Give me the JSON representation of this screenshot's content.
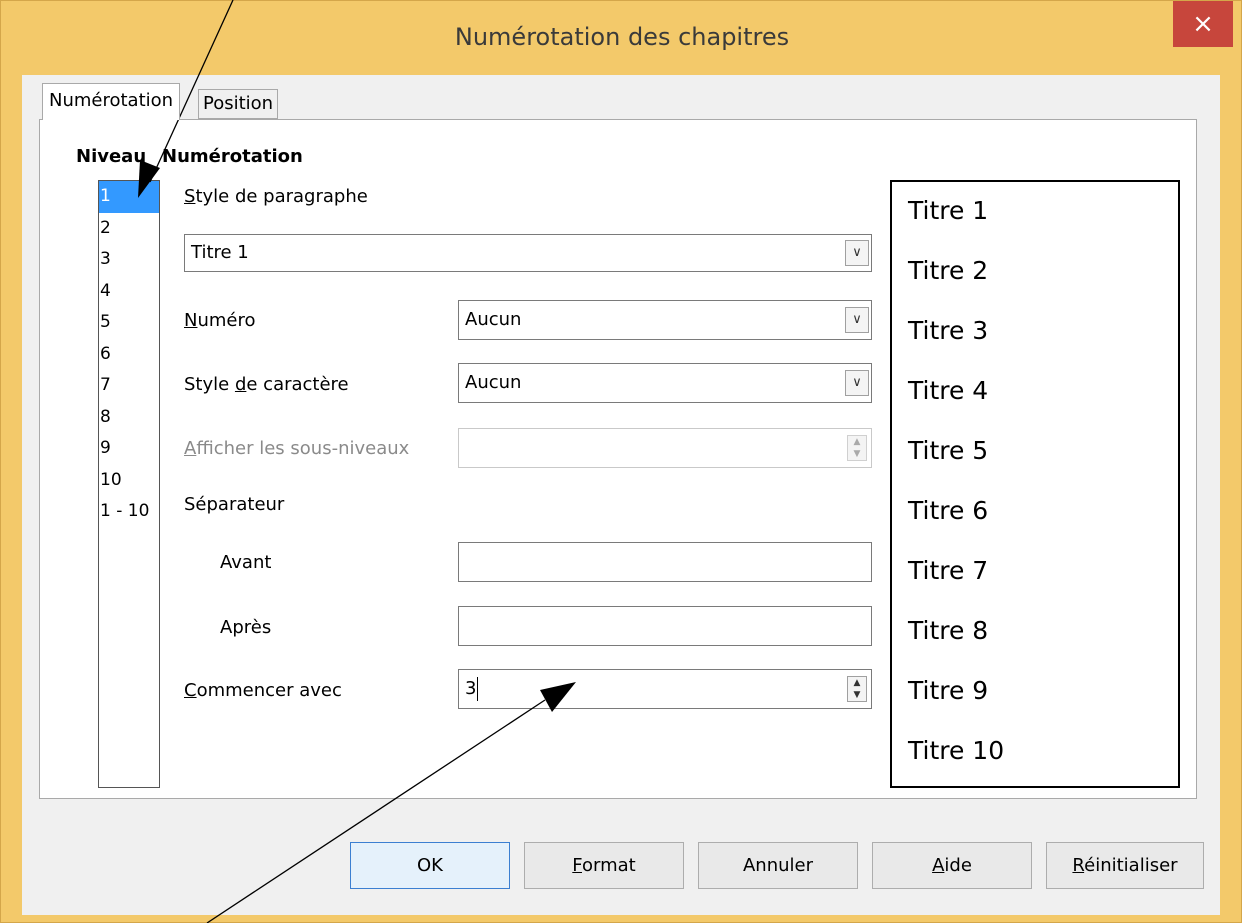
{
  "window": {
    "title": "Numérotation des chapitres",
    "close_glyph": "×"
  },
  "tabs": [
    {
      "label": "Numérotation"
    },
    {
      "label": "Position"
    }
  ],
  "sections": {
    "niveau": "Niveau",
    "numerotation": "Numérotation"
  },
  "levels": [
    "1",
    "2",
    "3",
    "4",
    "5",
    "6",
    "7",
    "8",
    "9",
    "10",
    "1 - 10"
  ],
  "selected_level": "1",
  "fields": {
    "style_paragraphe": {
      "label": "Style de paragraphe",
      "mnemonic": "S",
      "rest": "tyle de paragraphe",
      "value": "Titre 1"
    },
    "numero": {
      "label": "Numéro",
      "mnemonic": "N",
      "rest": "uméro",
      "value": "Aucun"
    },
    "style_caractere": {
      "label": "Style de caractère",
      "pre": "Style ",
      "mnemonic": "d",
      "rest": "e caractère",
      "value": "Aucun"
    },
    "sous_niveaux": {
      "label": "Afficher les sous-niveaux",
      "mnemonic": "A",
      "rest": "fficher les sous-niveaux",
      "value": ""
    },
    "separateur": {
      "label": "Séparateur"
    },
    "avant": {
      "label": "Avant",
      "value": ""
    },
    "apres": {
      "label": "Après",
      "value": ""
    },
    "commencer": {
      "label": "Commencer avec",
      "mnemonic": "C",
      "rest": "ommencer avec",
      "value": "3"
    }
  },
  "preview": [
    "Titre 1",
    "Titre 2",
    "Titre 3",
    "Titre 4",
    "Titre 5",
    "Titre 6",
    "Titre 7",
    "Titre 8",
    "Titre 9",
    "Titre 10"
  ],
  "buttons": {
    "ok": {
      "label": "OK"
    },
    "format": {
      "label": "Format",
      "mnemonic": "F",
      "rest": "ormat"
    },
    "annuler": {
      "label": "Annuler"
    },
    "aide": {
      "label": "Aide",
      "mnemonic": "A",
      "rest": "ide"
    },
    "reinitialiser": {
      "label": "Réinitialiser",
      "mnemonic": "R",
      "rest": "éinitialiser"
    }
  },
  "icons": {
    "dropdown": "chevron-down-icon",
    "spin": "spin-arrows-icon",
    "close": "close-icon"
  },
  "colors": {
    "titlebar": "#f3c96a",
    "close": "#c7463c",
    "selection": "#3399ff"
  }
}
